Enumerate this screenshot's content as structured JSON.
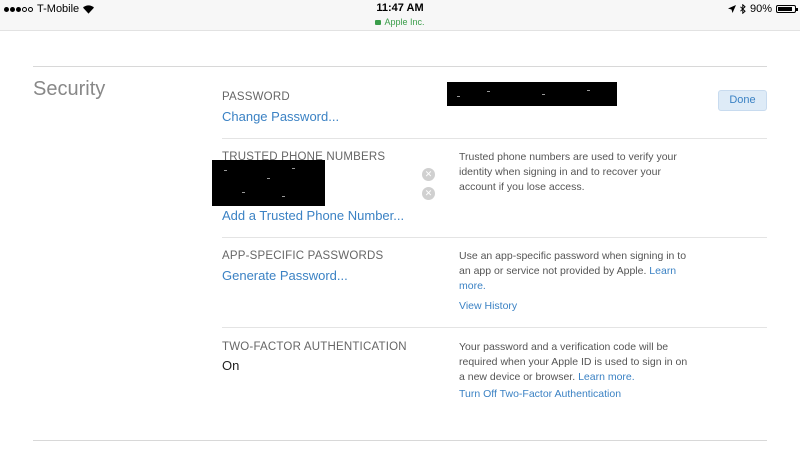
{
  "status_bar": {
    "carrier": "T-Mobile",
    "time": "11:47 AM",
    "url": "Apple Inc.",
    "battery": "90%",
    "battery_level": 0.9,
    "signal_bars_filled": 3,
    "signal_bars_total": 5,
    "icons": [
      "wifi-icon",
      "location-icon",
      "bluetooth-icon",
      "battery-icon",
      "lock-icon"
    ]
  },
  "section": {
    "title": "Security",
    "done_label": "Done"
  },
  "password": {
    "label": "PASSWORD",
    "link": "Change Password..."
  },
  "trusted_phones": {
    "label": "TRUSTED PHONE NUMBERS",
    "add_link": "Add a Trusted Phone Number...",
    "description": "Trusted phone numbers are used to verify your identity when signing in and to recover your account if you lose access."
  },
  "app_passwords": {
    "label": "APP-SPECIFIC PASSWORDS",
    "link": "Generate Password...",
    "description": "Use an app-specific password when signing in to an app or service not provided by Apple.",
    "learn_more": "Learn more.",
    "view_history": "View History"
  },
  "two_factor": {
    "label": "TWO-FACTOR AUTHENTICATION",
    "value": "On",
    "description": "Your password and a verification code will be required when your Apple ID is used to sign in on a new device or browser.",
    "learn_more": "Learn more.",
    "turn_off": "Turn Off Two-Factor Authentication"
  },
  "colors": {
    "link": "#3b82c4",
    "secure_url": "#3a9d4a",
    "done_bg": "#deebf7"
  }
}
